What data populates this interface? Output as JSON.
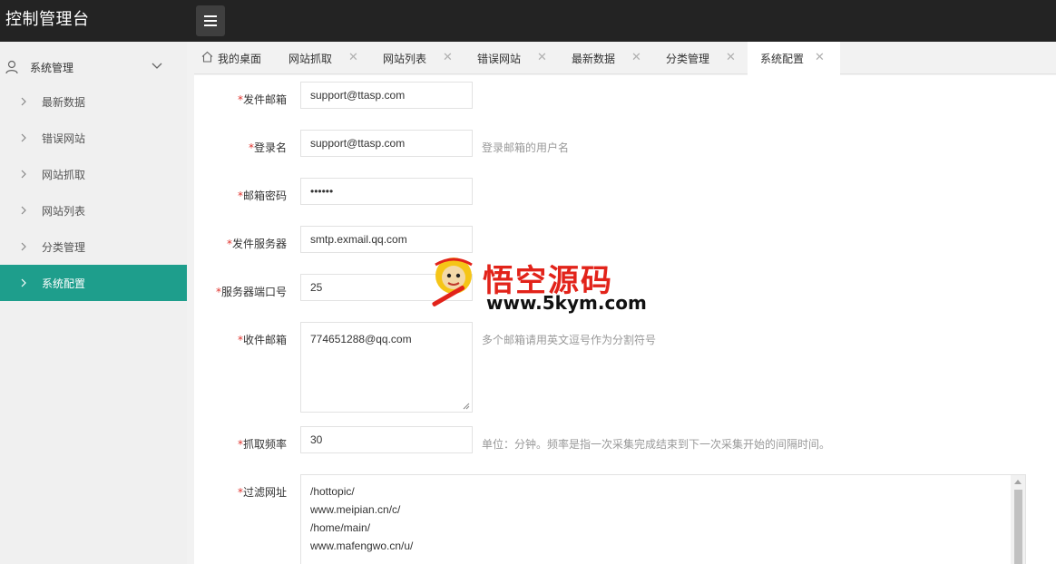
{
  "app": {
    "title": "控制管理台"
  },
  "header": {
    "menu_icon": "hamburger-icon"
  },
  "sidebar": {
    "group": {
      "label": "系统管理",
      "icon": "user-icon",
      "chevron": "chevron-down-icon"
    },
    "items": [
      {
        "label": "最新数据"
      },
      {
        "label": "错误网站"
      },
      {
        "label": "网站抓取"
      },
      {
        "label": "网站列表"
      },
      {
        "label": "分类管理"
      },
      {
        "label": "系统配置",
        "active": true
      }
    ]
  },
  "tabs": [
    {
      "label": "我的桌面",
      "icon": "home-icon"
    },
    {
      "label": "网站抓取",
      "close": "✕"
    },
    {
      "label": "网站列表",
      "close": "✕"
    },
    {
      "label": "错误网站",
      "close": "✕"
    },
    {
      "label": "最新数据",
      "close": "✕"
    },
    {
      "label": "分类管理",
      "close": "✕"
    },
    {
      "label": "系统配置",
      "close": "✕",
      "active": true
    }
  ],
  "form": {
    "required_mark": "*",
    "sender_email": {
      "label": "发件邮箱",
      "value": "support@ttasp.com"
    },
    "login_name": {
      "label": "登录名",
      "value": "support@ttasp.com",
      "hint": "登录邮箱的用户名"
    },
    "email_password": {
      "label": "邮箱密码",
      "value": "••••••"
    },
    "smtp_server": {
      "label": "发件服务器",
      "value": "smtp.exmail.qq.com"
    },
    "server_port": {
      "label": "服务器端口号",
      "value": "25"
    },
    "recipient_email": {
      "label": "收件邮箱",
      "value": "774651288@qq.com",
      "hint": "多个邮箱请用英文逗号作为分割符号"
    },
    "crawl_frequency": {
      "label": "抓取频率",
      "value": "30",
      "hint": "单位：分钟。频率是指一次采集完成结束到下一次采集开始的间隔时间。"
    },
    "filter_urls": {
      "label": "过滤网址",
      "lines": [
        "/hottopic/",
        "www.meipian.cn/c/",
        "/home/main/",
        "www.mafengwo.cn/u/"
      ]
    }
  },
  "watermark": {
    "text": "悟空源码",
    "url": "www.5kym.com"
  },
  "colors": {
    "header_bg": "#232323",
    "active_green": "#1e9e8c",
    "required_red": "#e0352f",
    "watermark_red": "#e2231a"
  }
}
